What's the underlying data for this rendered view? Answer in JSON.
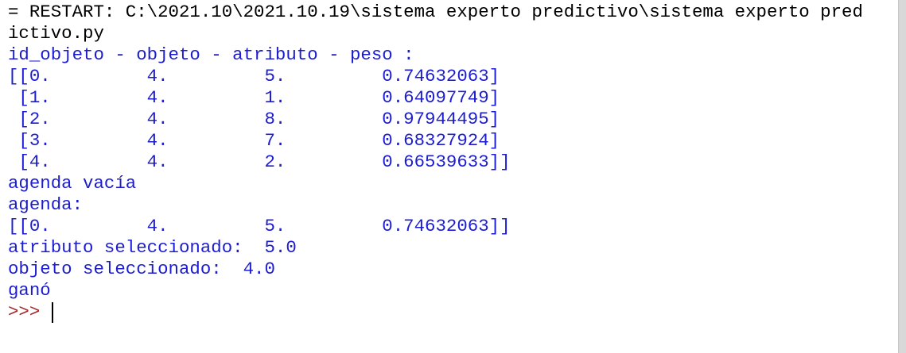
{
  "shell": {
    "lines": [
      {
        "kind": "restart",
        "text": "= RESTART: C:\\2021.10\\2021.10.19\\sistema experto predictivo\\sistema experto pred"
      },
      {
        "kind": "restart",
        "text": "ictivo.py"
      },
      {
        "kind": "out",
        "text": "id_objeto - objeto - atributo - peso :"
      },
      {
        "kind": "out",
        "text": "[[0.         4.         5.         0.74632063]"
      },
      {
        "kind": "out",
        "text": " [1.         4.         1.         0.64097749]"
      },
      {
        "kind": "out",
        "text": " [2.         4.         8.         0.97944495]"
      },
      {
        "kind": "out",
        "text": " [3.         4.         7.         0.68327924]"
      },
      {
        "kind": "out",
        "text": " [4.         4.         2.         0.66539633]]"
      },
      {
        "kind": "out",
        "text": "agenda vacía"
      },
      {
        "kind": "out",
        "text": "agenda:"
      },
      {
        "kind": "out",
        "text": "[[0.         4.         5.         0.74632063]]"
      },
      {
        "kind": "out",
        "text": "atributo seleccionado:  5.0"
      },
      {
        "kind": "out",
        "text": "objeto seleccionado:  4.0"
      },
      {
        "kind": "out",
        "text": "ganó"
      }
    ],
    "prompt": ">>> "
  },
  "colors": {
    "output": "#1c1cd0",
    "restart": "#000000",
    "prompt": "#a12a2a"
  }
}
